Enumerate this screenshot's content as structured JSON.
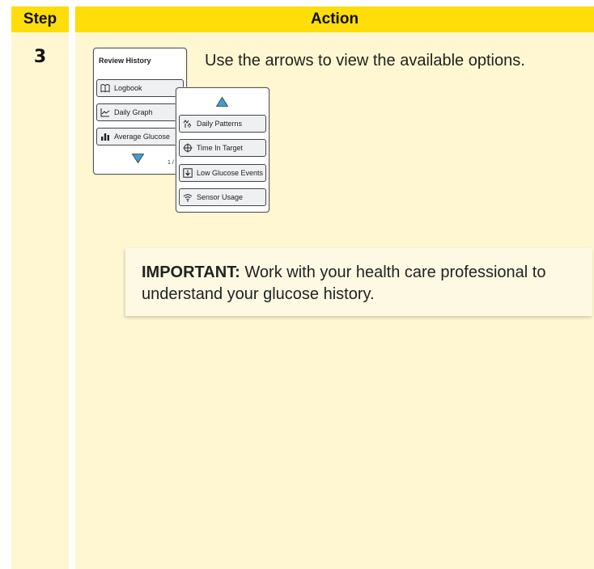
{
  "header": {
    "step_label": "Step",
    "action_label": "Action"
  },
  "step": {
    "number": "3"
  },
  "instruction": "Use the arrows to view the available options.",
  "screen1": {
    "title": "Review History",
    "items": [
      {
        "label": "Logbook",
        "icon": "book-icon"
      },
      {
        "label": "Daily Graph",
        "icon": "line-graph-icon"
      },
      {
        "label": "Average Glucose",
        "icon": "bar-chart-icon"
      }
    ],
    "page": "1 /"
  },
  "screen2": {
    "items": [
      {
        "label": "Daily Patterns",
        "icon": "daily-patterns-icon"
      },
      {
        "label": "Time In Target",
        "icon": "target-icon"
      },
      {
        "label": "Low Glucose Events",
        "icon": "low-glucose-icon"
      },
      {
        "label": "Sensor Usage",
        "icon": "wireless-icon"
      }
    ]
  },
  "important": {
    "label": "IMPORTANT:",
    "text": "Work with your health care professional to understand your glucose history."
  },
  "colors": {
    "header": "#fedd09",
    "body": "#fff7d1",
    "note": "#fef9e2",
    "arrow": "#3f9fcf"
  }
}
